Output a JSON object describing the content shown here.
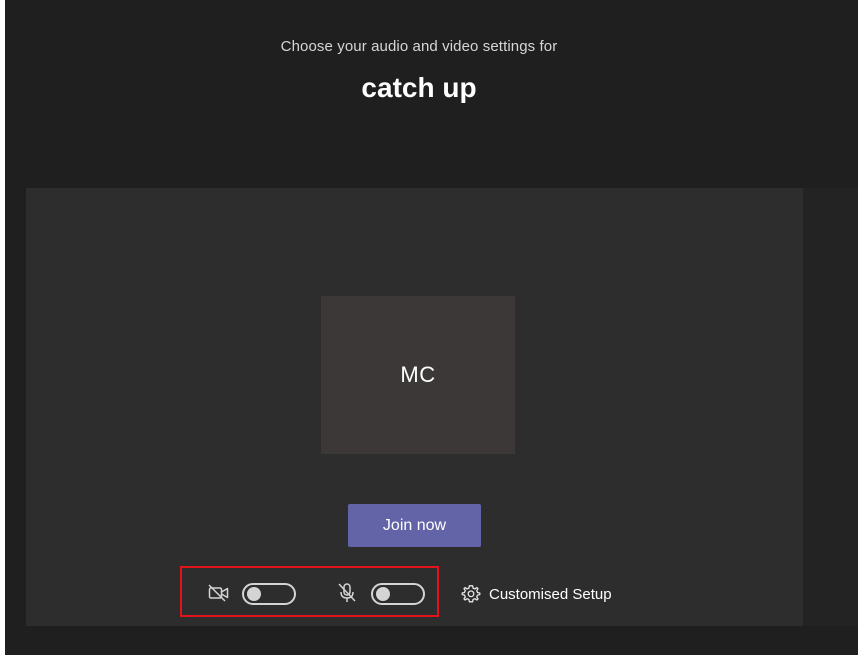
{
  "prejoin": {
    "subtitle": "Choose your audio and video settings for",
    "meeting_title": "catch up"
  },
  "preview": {
    "avatar_initials": "MC",
    "join_label": "Join now"
  },
  "controls": {
    "camera": {
      "icon": "camera-off-icon",
      "state": "off"
    },
    "microphone": {
      "icon": "mic-off-icon",
      "state": "off"
    },
    "setup": {
      "icon": "gear-icon",
      "label": "Customised Setup"
    }
  },
  "colors": {
    "background": "#201f1f",
    "preview_panel": "#2e2d2d",
    "avatar_tile": "#3b3837",
    "join_button": "#6264a7",
    "highlight": "#e3131b",
    "toggle": "#d4d4d4"
  }
}
